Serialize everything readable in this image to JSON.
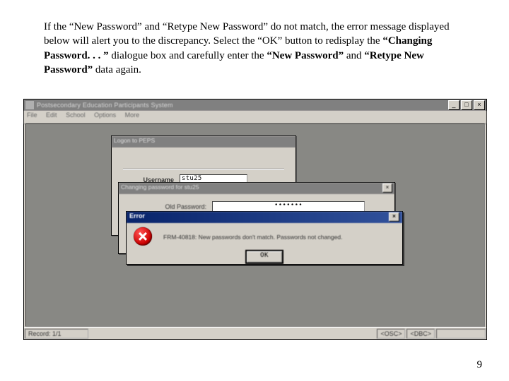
{
  "instruction": {
    "p1a": "If the “New Password” and “Retype New Password” do not match, the error message displayed below will alert you to the discrepancy.  Select the “OK” button to redisplay the ",
    "p1b": "“Changing Password. . . ”",
    "p1c": " dialogue box and carefully enter the ",
    "p1d": "“New Password”",
    "p1e": " and ",
    "p1f": "“Retype New Password”",
    "p1g": " data again."
  },
  "appwin": {
    "title": "Postsecondary Education Participants System",
    "menus": [
      "File",
      "Edit",
      "School",
      "Options",
      "More"
    ],
    "controls": {
      "min": "_",
      "max": "□",
      "close": "×"
    }
  },
  "logon": {
    "title": "Logon to PEPS",
    "username_label": "Username",
    "username_value": "stu25"
  },
  "chgpwd": {
    "title": "Changing password for stu25",
    "old_label": "Old Password:",
    "old_value": "•••••••",
    "close": "×"
  },
  "error": {
    "title": "Error",
    "message": "FRM-40818: New passwords don't match. Passwords not changed.",
    "ok_label": "OK",
    "close": "×"
  },
  "status": {
    "record": "Record: 1/1",
    "ind1": "<OSC>",
    "ind2": "<DBC>"
  },
  "page_number": "9"
}
